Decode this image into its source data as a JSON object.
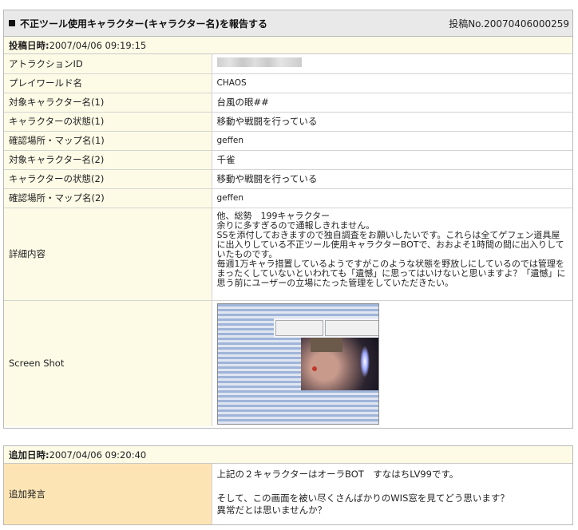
{
  "report": {
    "title": "不正ツール使用キャラクター(キャラクター名)を報告する",
    "post_no": "投稿No.20070406000259",
    "date_label": "投稿日時:",
    "date_value": "2007/04/06 09:19:15",
    "rows": [
      {
        "label": "アトラクションID",
        "value": ""
      },
      {
        "label": "プレイワールド名",
        "value": "CHAOS"
      },
      {
        "label": "対象キャラクター名(1)",
        "value": "台風の眼##"
      },
      {
        "label": "キャラクターの状態(1)",
        "value": "移動や戦闘を行っている"
      },
      {
        "label": "確認場所・マップ名(1)",
        "value": "geffen"
      },
      {
        "label": "対象キャラクター名(2)",
        "value": "千雀"
      },
      {
        "label": "キャラクターの状態(2)",
        "value": "移動や戦闘を行っている"
      },
      {
        "label": "確認場所・マップ名(2)",
        "value": "geffen"
      }
    ],
    "detail_label": "詳細内容",
    "detail_text": "他、総勢　199キャラクター\n余りに多すぎるので通報しきれません。\nSSを添付しておきますので独自調査をお願いしたいです。これらは全てゲフェン道具屋に出入りしている不正ツール使用キャラクターBOTで、おおよそ1時間の間に出入りしていたものです。\n毎週1万キャラ措置しているようですがこのような状態を野放しにしているのでは管理をまったくしていないといわれても「遺憾」に思ってはいけないと思いますよ？「遺憾」に思う前にユーザーの立場にたった管理をしていただきたい。",
    "shot_label": "Screen Shot"
  },
  "addition": {
    "date_label": "追加日時:",
    "date_value": "2007/04/06 09:20:40",
    "label": "追加発言",
    "text": "上記の２キャラクターはオーラBOT　すなはちLV99です。\n\nそして、この画面を被い尽くさんばかりのWIS窓を見てどう思います？\n異常だとは思いませんか？"
  }
}
